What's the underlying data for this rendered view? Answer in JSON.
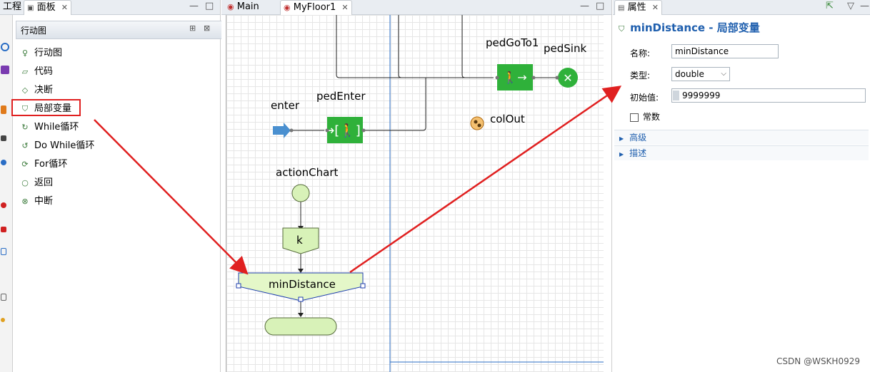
{
  "left_strip": {
    "tab_project": "工程",
    "tab_palette": "面板"
  },
  "palette": {
    "header": "行动图",
    "items": [
      {
        "label": "行动图",
        "icon": "action-chart-icon"
      },
      {
        "label": "代码",
        "icon": "code-icon"
      },
      {
        "label": "决断",
        "icon": "decision-icon"
      },
      {
        "label": "局部变量",
        "icon": "local-variable-icon"
      },
      {
        "label": "While循环",
        "icon": "while-loop-icon"
      },
      {
        "label": "Do While循环",
        "icon": "do-while-loop-icon"
      },
      {
        "label": "For循环",
        "icon": "for-loop-icon"
      },
      {
        "label": "返回",
        "icon": "return-icon"
      },
      {
        "label": "中断",
        "icon": "break-icon"
      }
    ]
  },
  "editor": {
    "tabs": [
      {
        "label": "Main",
        "active": false
      },
      {
        "label": "MyFloor1",
        "active": true
      }
    ],
    "blocks": {
      "pedGoTo1": "pedGoTo1",
      "pedSink": "pedSink",
      "enter": "enter",
      "pedEnter": "pedEnter",
      "colOut": "colOut",
      "actionChart": "actionChart",
      "code_block": "k",
      "local_var": "minDistance"
    }
  },
  "properties": {
    "tab_label": "属性",
    "title": "minDistance - 局部变量",
    "name_label": "名称:",
    "name_value": "minDistance",
    "type_label": "类型:",
    "type_value": "double",
    "init_label": "初始值:",
    "init_value": "9999999",
    "constant_label": "常数",
    "constant_checked": false,
    "section_advanced": "高级",
    "section_description": "描述"
  },
  "watermark": "CSDN @WSKH0929",
  "colors": {
    "accent_blue": "#1f5fae",
    "block_green": "#2fb13a",
    "arrow_red": "#e02020"
  }
}
